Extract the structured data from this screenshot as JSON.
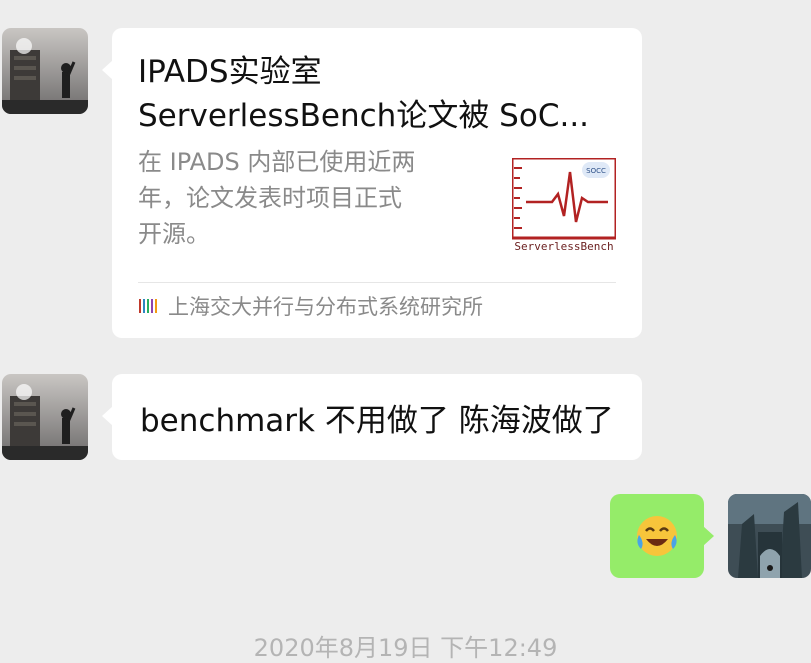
{
  "messages": {
    "card": {
      "title": "IPADS实验室\nServerlessBench论文被 SoC...",
      "description": "在 IPADS 内部已使用近两\n年，论文发表时项目正式\n开源。",
      "thumbnail_caption": "ServerlessBench",
      "thumbnail_badge": "SOCC",
      "source": "上海交大并行与分布式系统研究所"
    },
    "text": "benchmark 不用做了 陈海波做了"
  },
  "timestamp": "2020年8月19日 下午12:49",
  "colors": {
    "background": "#ededed",
    "bubble_other": "#ffffff",
    "bubble_self": "#95ec69",
    "secondary_text": "#8a8a8a",
    "thumbnail_accent": "#b22222"
  },
  "icons": {
    "source": "publisher-logo-icon",
    "emoji": "crying-laughing-emoji",
    "avatar_other": "avatar-photo-building-person",
    "avatar_self": "avatar-photo-castle"
  }
}
